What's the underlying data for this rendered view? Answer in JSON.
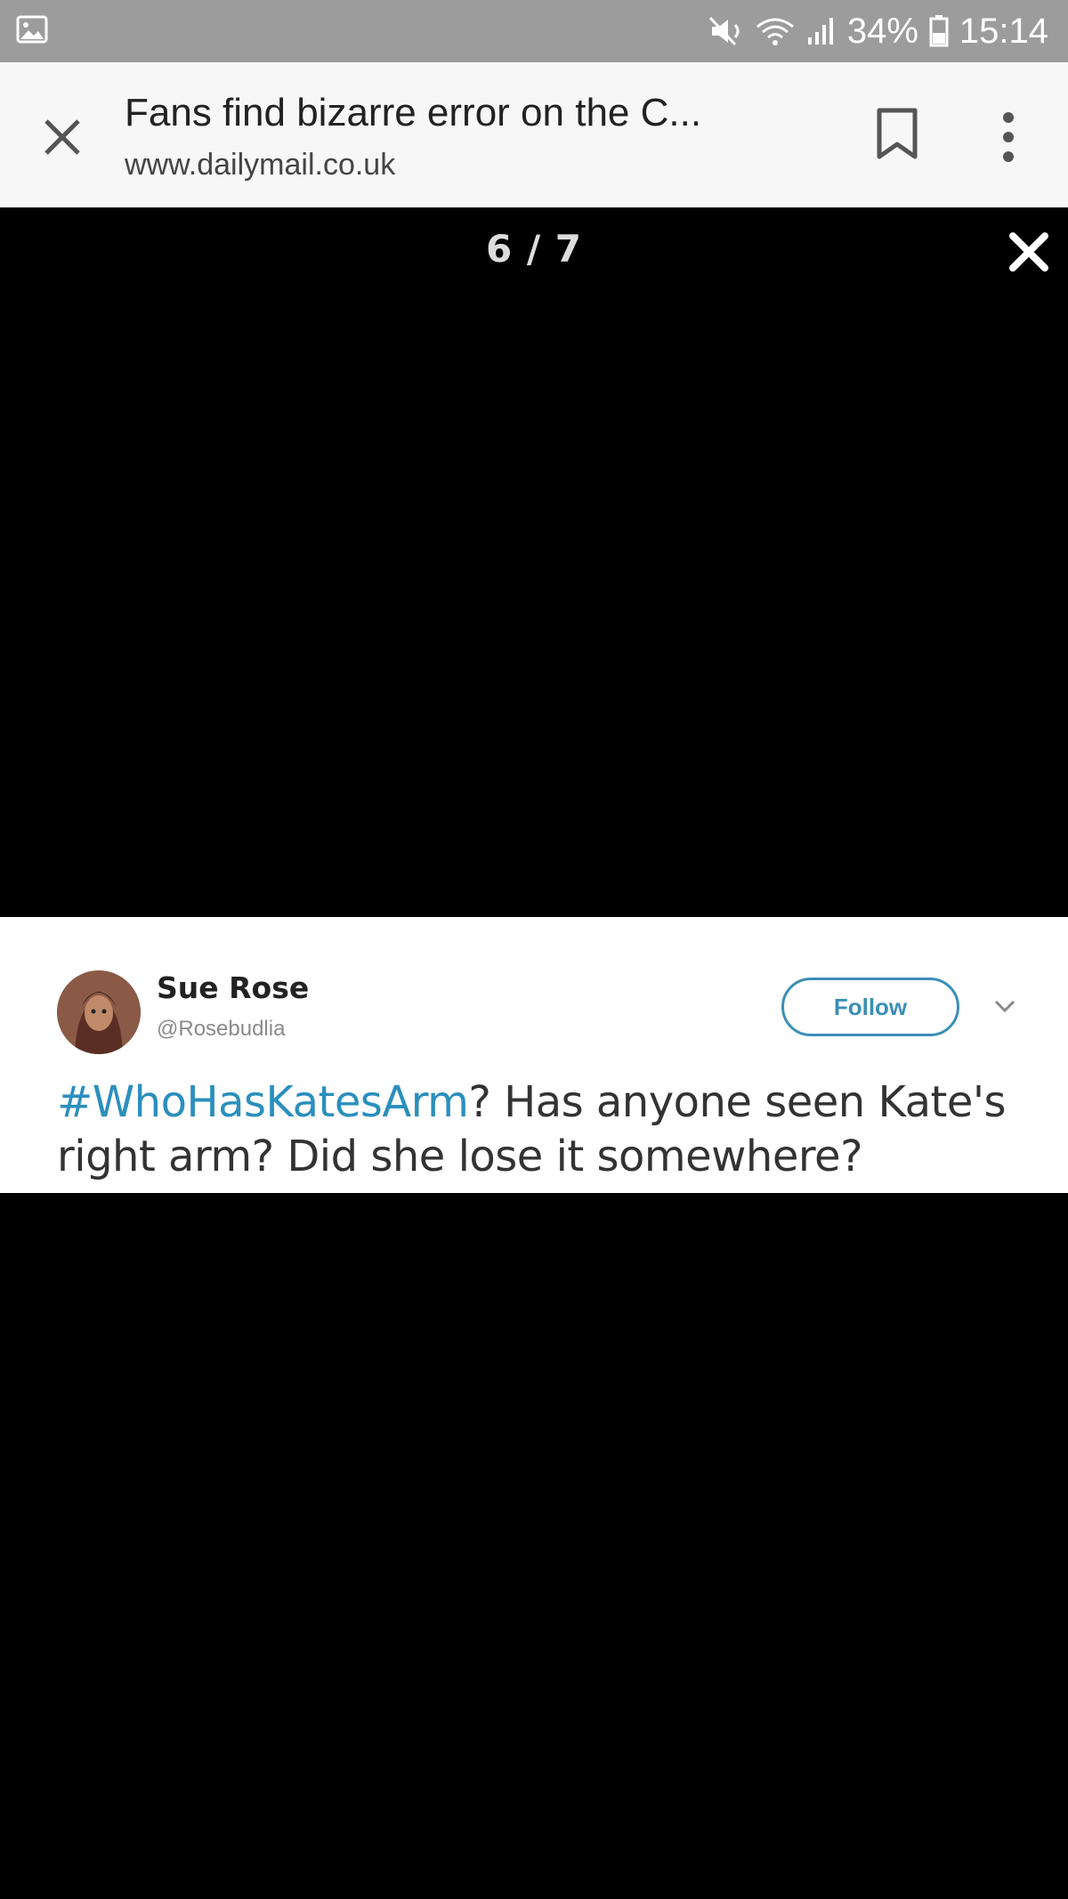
{
  "status_bar": {
    "battery": "34%",
    "time": "15:14",
    "icons": [
      "image-notification-icon",
      "mute-icon",
      "wifi-icon",
      "signal-icon",
      "battery-icon"
    ]
  },
  "toolbar": {
    "title": "Fans find bizarre error on the C...",
    "url": "www.dailymail.co.uk",
    "icons": [
      "close-icon",
      "bookmark-icon",
      "more-vert-icon"
    ]
  },
  "viewer": {
    "counter": "6 / 7",
    "icons": [
      "close-icon"
    ]
  },
  "tweet": {
    "author_name": "Sue Rose",
    "author_handle": "@Rosebudlia",
    "follow_label": "Follow",
    "hashtag": "#WhoHasKatesArm",
    "body_line1_rest": "?  Has anyone seen Kate's",
    "body_line2": "right arm?  Did she lose it somewhere?",
    "colors": {
      "link": "#2b8fbd",
      "follow_border": "#3a8fb7"
    }
  }
}
